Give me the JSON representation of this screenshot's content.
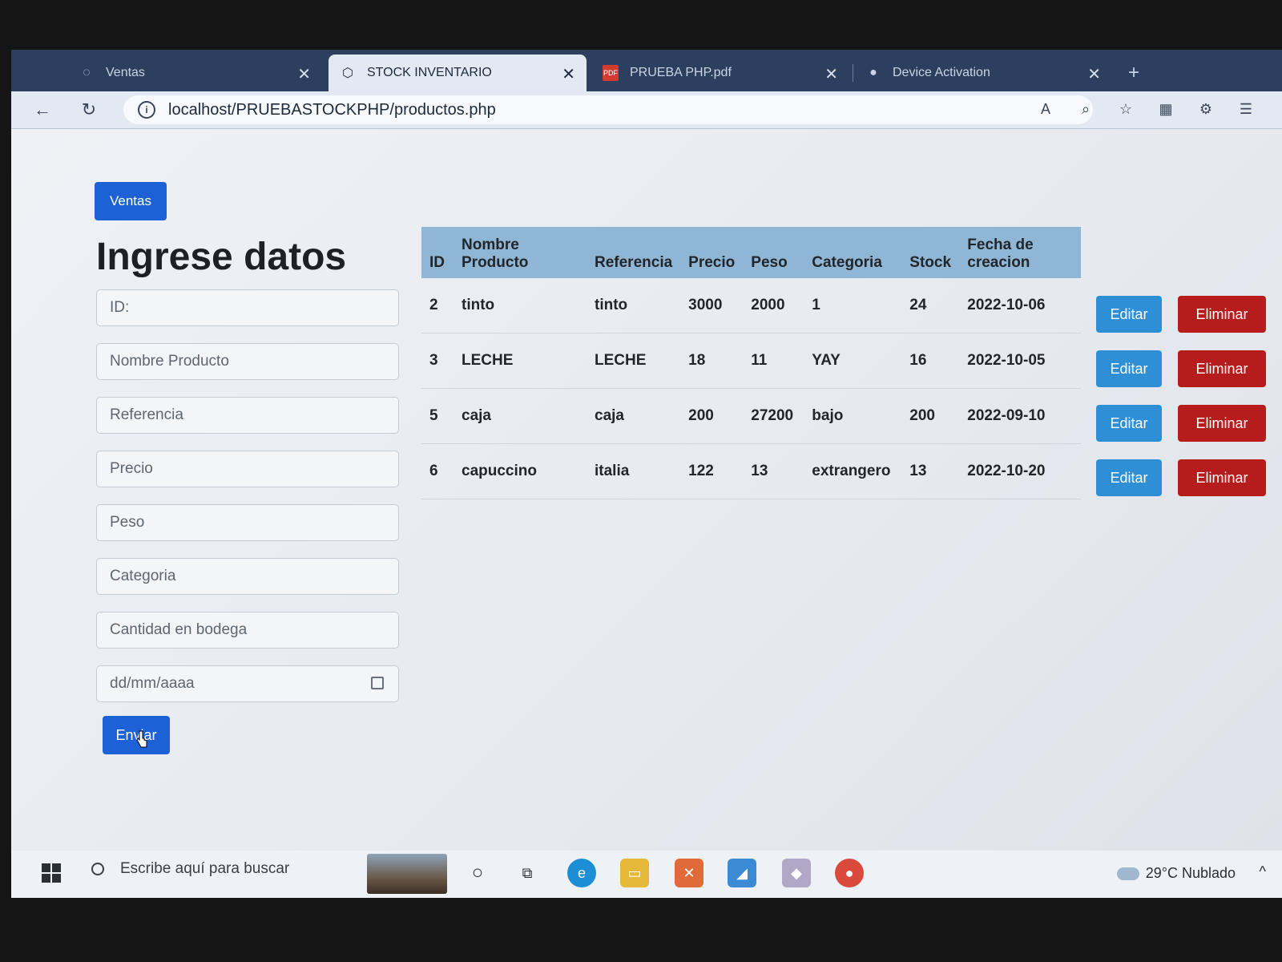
{
  "browser": {
    "tabs": [
      {
        "title": "Ventas",
        "active": false
      },
      {
        "title": "STOCK INVENTARIO",
        "active": true
      },
      {
        "title": "PRUEBA PHP.pdf",
        "active": false
      },
      {
        "title": "Device Activation",
        "active": false
      }
    ],
    "url": "localhost/PRUEBASTOCKPHP/productos.php"
  },
  "page": {
    "ventas_button": "Ventas",
    "title": "Ingrese datos",
    "form": {
      "placeholders": [
        "ID:",
        "Nombre Producto",
        "Referencia",
        "Precio",
        "Peso",
        "Categoria",
        "Cantidad en bodega",
        "dd/mm/aaaa"
      ],
      "submit": "Enviar"
    },
    "table": {
      "headers": [
        "ID",
        "Nombre Producto",
        "Referencia",
        "Precio",
        "Peso",
        "Categoria",
        "Stock",
        "Fecha de creacion"
      ],
      "rows": [
        [
          "2",
          "tinto",
          "tinto",
          "3000",
          "2000",
          "1",
          "24",
          "2022-10-06"
        ],
        [
          "3",
          "LECHE",
          "LECHE",
          "18",
          "11",
          "YAY",
          "16",
          "2022-10-05"
        ],
        [
          "5",
          "caja",
          "caja",
          "200",
          "27200",
          "bajo",
          "200",
          "2022-09-10"
        ],
        [
          "6",
          "capuccino",
          "italia",
          "122",
          "13",
          "extrangero",
          "13",
          "2022-10-20"
        ]
      ],
      "edit_label": "Editar",
      "delete_label": "Eliminar"
    }
  },
  "taskbar": {
    "search_placeholder": "Escribe aquí para buscar",
    "weather": "29°C  Nublado"
  },
  "colors": {
    "primary": "#1d61d6",
    "edit": "#2f8fd6",
    "delete": "#b71c1c",
    "table_header": "#8fb6d4"
  }
}
